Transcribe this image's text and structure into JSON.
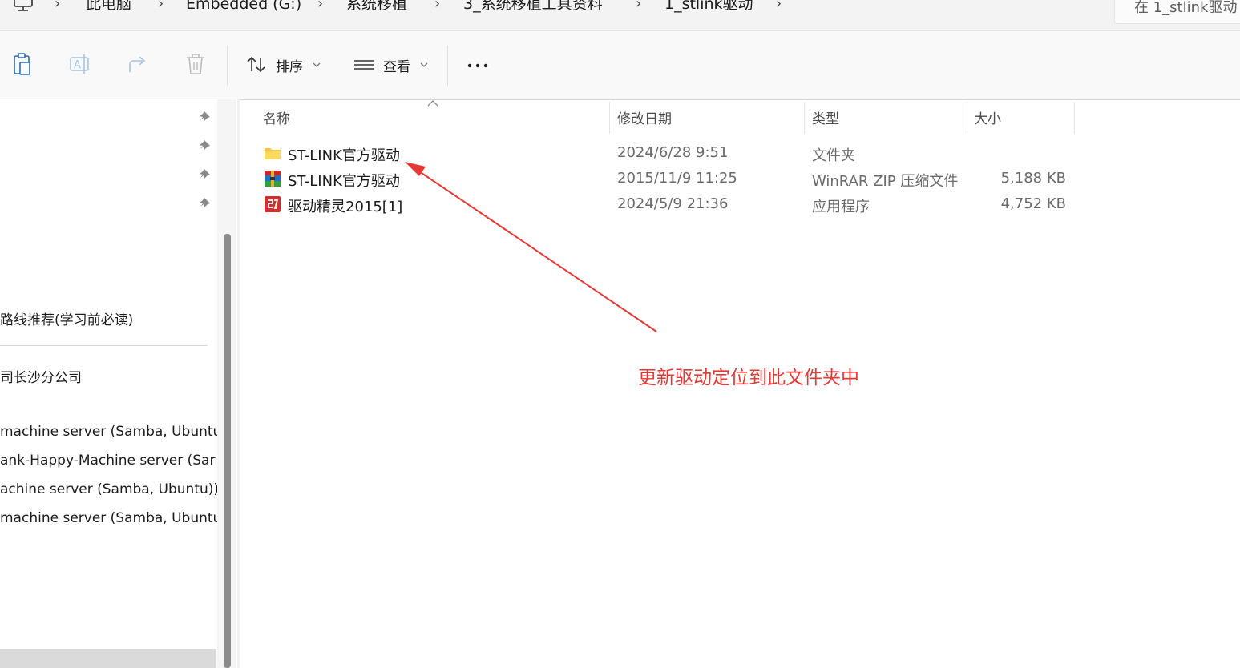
{
  "breadcrumb": {
    "items": [
      "此电脑",
      "Embedded (G:)",
      "系统移植",
      "3_系统移植工具资料",
      "1_stlink驱动"
    ],
    "search_placeholder": "在 1_stlink驱动"
  },
  "toolbar": {
    "sort_label": "排序",
    "view_label": "查看"
  },
  "sidebar": {
    "items": [
      "路线推荐(学习前必读)",
      "司长沙分公司",
      "machine server (Samba, Ubuntu",
      "ank-Happy-Machine server (Sar",
      "achine server (Samba, Ubuntu)))",
      "machine server (Samba, Ubuntu)"
    ]
  },
  "columns": [
    "名称",
    "修改日期",
    "类型",
    "大小"
  ],
  "files": [
    {
      "name": "ST-LINK官方驱动",
      "date": "2024/6/28 9:51",
      "type": "文件夹",
      "size": "",
      "icon": "folder-icon"
    },
    {
      "name": "ST-LINK官方驱动",
      "date": "2015/11/9 11:25",
      "type": "WinRAR ZIP 压缩文件",
      "size": "5,188 KB",
      "icon": "winrar-zip-icon"
    },
    {
      "name": "驱动精灵2015[1]",
      "date": "2024/5/9 21:36",
      "type": "应用程序",
      "size": "4,752 KB",
      "icon": "app-icon"
    }
  ],
  "annotation": {
    "text": "更新驱动定位到此文件夹中",
    "color": "#e53935"
  }
}
